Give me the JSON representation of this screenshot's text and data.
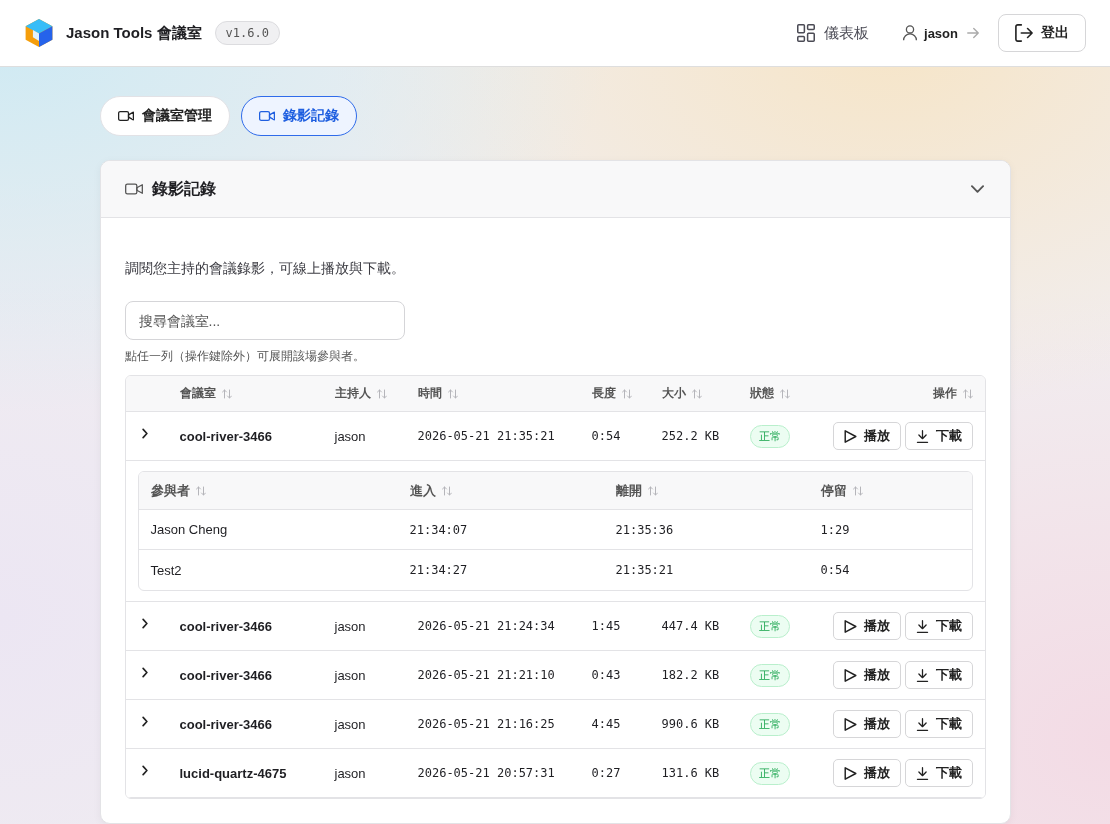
{
  "header": {
    "app_title": "Jason Tools 會議室",
    "version": "v1.6.0",
    "dashboard_link": "儀表板",
    "user_link": "jason",
    "logout_button": "登出"
  },
  "tabs": [
    {
      "label": "會議室管理",
      "selected": false
    },
    {
      "label": "錄影記錄",
      "selected": true
    }
  ],
  "panel": {
    "title": "錄影記錄",
    "expanded": true,
    "description": "調閱您主持的會議錄影，可線上播放與下載。",
    "search": {
      "placeholder": "搜尋會議室..."
    },
    "hint": "點任一列（操作鍵除外）可展開該場參與者。",
    "table": {
      "columns": [
        "會議室",
        "主持人",
        "時間",
        "長度",
        "大小",
        "狀態",
        "操作"
      ],
      "rows": [
        {
          "expanded": true,
          "room": "cool-river-3466",
          "host": "jason",
          "time": "2026-05-21 21:35:21",
          "duration": "0:54",
          "size": "252.2 KB",
          "status": "正常",
          "actions": [
            {
              "label": "播放",
              "kind": "play"
            },
            {
              "label": "下載",
              "kind": "download"
            }
          ],
          "participants": {
            "columns": [
              "參與者",
              "進入",
              "離開",
              "停留"
            ],
            "rows": [
              {
                "name": "Jason Cheng",
                "joined": "21:34:07",
                "left": "21:35:36",
                "stay": "1:29"
              },
              {
                "name": "Test2",
                "joined": "21:34:27",
                "left": "21:35:21",
                "stay": "0:54"
              }
            ]
          }
        },
        {
          "expanded": false,
          "room": "cool-river-3466",
          "host": "jason",
          "time": "2026-05-21 21:24:34",
          "duration": "1:45",
          "size": "447.4 KB",
          "status": "正常",
          "actions": [
            {
              "label": "播放",
              "kind": "play"
            },
            {
              "label": "下載",
              "kind": "download"
            }
          ]
        },
        {
          "expanded": false,
          "room": "cool-river-3466",
          "host": "jason",
          "time": "2026-05-21 21:21:10",
          "duration": "0:43",
          "size": "182.2 KB",
          "status": "正常",
          "actions": [
            {
              "label": "播放",
              "kind": "play"
            },
            {
              "label": "下載",
              "kind": "download"
            }
          ]
        },
        {
          "expanded": false,
          "room": "cool-river-3466",
          "host": "jason",
          "time": "2026-05-21 21:16:25",
          "duration": "4:45",
          "size": "990.6 KB",
          "status": "正常",
          "actions": [
            {
              "label": "播放",
              "kind": "play"
            },
            {
              "label": "下載",
              "kind": "download"
            }
          ]
        },
        {
          "expanded": false,
          "room": "lucid-quartz-4675",
          "host": "jason",
          "time": "2026-05-21 20:57:31",
          "duration": "0:27",
          "size": "131.6 KB",
          "status": "正常",
          "actions": [
            {
              "label": "播放",
              "kind": "play"
            },
            {
              "label": "下載",
              "kind": "download"
            }
          ]
        }
      ]
    }
  }
}
